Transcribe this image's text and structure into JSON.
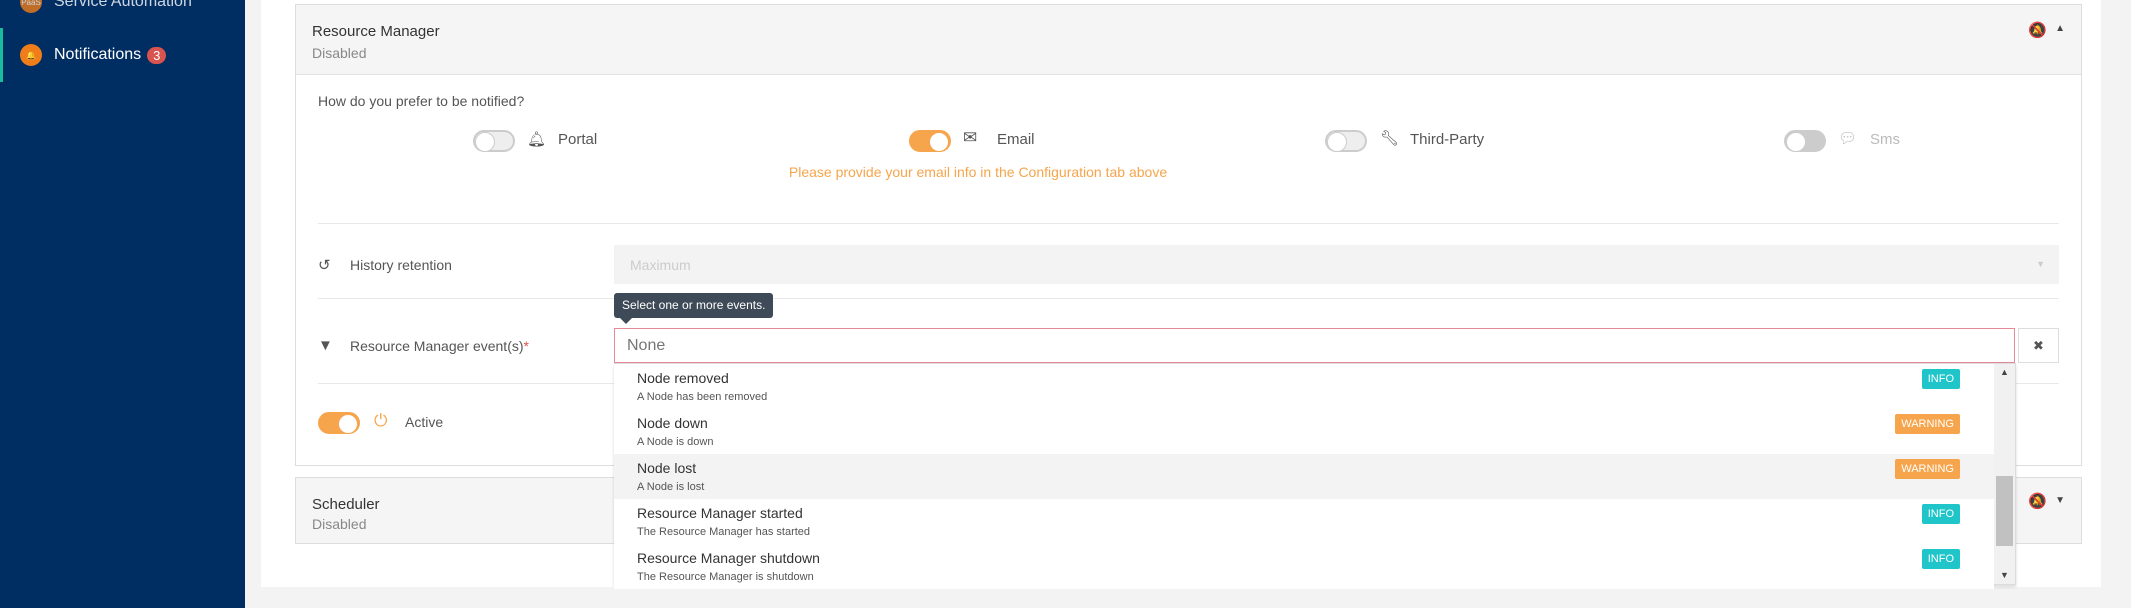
{
  "sidebar": {
    "items": [
      {
        "label": "Service Automation",
        "icon": "paas-icon"
      },
      {
        "label": "Notifications",
        "badge": "3",
        "icon": "notification-bell-icon",
        "active": true
      }
    ]
  },
  "colors": {
    "sidebar": "#002d62",
    "accent": "#f6a54c",
    "info": "#1fc5c8",
    "badge": "#d9534f",
    "active_indicator": "#1abc9c"
  },
  "resource_manager": {
    "title": "Resource Manager",
    "status": "Disabled",
    "question": "How do you prefer to be notified?",
    "channels": [
      {
        "label": "Portal",
        "icon": "bell-icon",
        "on": false
      },
      {
        "label": "Email",
        "icon": "envelope-icon",
        "on": true
      },
      {
        "label": "Third-Party",
        "icon": "wrench-icon",
        "on": false
      },
      {
        "label": "Sms",
        "icon": "comments-icon",
        "on": false,
        "disabled": true
      }
    ],
    "email_warning": "Please provide your email info in the Configuration tab above",
    "history_label": "History retention",
    "history_value": "Maximum",
    "events_label": "Resource Manager event(s)",
    "required_mark": "*",
    "tooltip": "Select one or more events.",
    "events_placeholder": "None",
    "active_label": "Active",
    "options": [
      {
        "title": "Node removed",
        "desc": "A Node has been removed",
        "level": "INFO"
      },
      {
        "title": "Node down",
        "desc": "A Node is down",
        "level": "WARNING"
      },
      {
        "title": "Node lost",
        "desc": "A Node is lost",
        "level": "WARNING",
        "highlighted": true
      },
      {
        "title": "Resource Manager started",
        "desc": "The Resource Manager has started",
        "level": "INFO"
      },
      {
        "title": "Resource Manager shutdown",
        "desc": "The Resource Manager is shutdown",
        "level": "INFO"
      }
    ]
  },
  "scheduler": {
    "title": "Scheduler",
    "status": "Disabled"
  }
}
